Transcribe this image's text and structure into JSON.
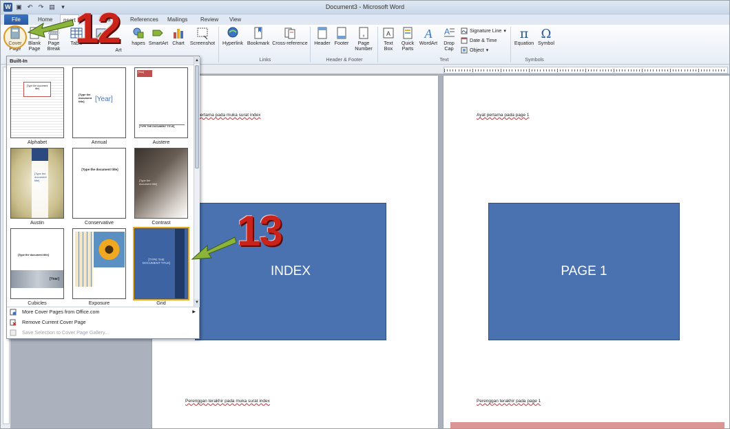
{
  "window": {
    "title": "Document3 - Microsoft Word"
  },
  "tabs": [
    "File",
    "Home",
    "Insert",
    "Page Layout",
    "References",
    "Mailings",
    "Review",
    "View"
  ],
  "tabs_visible": [
    "File",
    "Home",
    "nsert",
    "e La",
    "References",
    "Mailings",
    "Review",
    "View"
  ],
  "ribbon": {
    "pages": {
      "cover_page": "Cover\nPage",
      "blank_page": "Blank\nPage",
      "page_break": "Page\nBreak"
    },
    "tables": {
      "table": "Table"
    },
    "illustrations": {
      "art": "Art",
      "shapes": "hapes",
      "smartart": "SmartArt",
      "chart": "Chart",
      "screenshot": "Screenshot"
    },
    "links": {
      "hyperlink": "Hyperlink",
      "bookmark": "Bookmark",
      "cross_reference": "Cross-reference",
      "label": "Links"
    },
    "header_footer": {
      "header": "Header",
      "footer": "Footer",
      "page_number": "Page\nNumber",
      "label": "Header & Footer"
    },
    "text": {
      "text_box": "Text\nBox",
      "quick_parts": "Quick\nParts",
      "wordart": "WordArt",
      "drop_cap": "Drop\nCap",
      "signature_line": "Signature Line",
      "date_time": "Date & Time",
      "object": "Object",
      "label": "Text"
    },
    "symbols": {
      "equation": "Equation",
      "symbol": "Symbol",
      "label": "Symbols"
    }
  },
  "gallery": {
    "header": "Built-In",
    "items": [
      {
        "name": "Alphabet"
      },
      {
        "name": "Annual"
      },
      {
        "name": "Austere"
      },
      {
        "name": "Austin"
      },
      {
        "name": "Conservative"
      },
      {
        "name": "Contrast"
      },
      {
        "name": "Cubicles"
      },
      {
        "name": "Exposure"
      },
      {
        "name": "Grid"
      }
    ],
    "thumb_text": {
      "type_title": "[Type the document title]",
      "year": "[Year]",
      "type_title_upper": "[TYPE THE DOCUMENT TITLE]",
      "type_the_document_title_split": "[Type the document title]"
    },
    "menu": [
      {
        "label": "More Cover Pages from Office.com",
        "enabled": true
      },
      {
        "label": "Remove Current Cover Page",
        "enabled": true
      },
      {
        "label": "Save Selection to Cover Page Gallery...",
        "enabled": false
      }
    ]
  },
  "document": {
    "page1": {
      "top_text": "pertama pada muka surat index",
      "box_label": "INDEX",
      "bottom_text": "Perenggan terakhir pada muka surat index"
    },
    "page2": {
      "top_text": "Ayat pertama pada page 1",
      "box_label": "PAGE 1",
      "bottom_text": "Perenggan terakhir pada page 1"
    }
  },
  "annotations": {
    "step1": "12",
    "step2": "13"
  },
  "colors": {
    "accent": "#2b5797",
    "box_blue": "#4a72b0",
    "annotation_red": "#c9231c",
    "arrow_green": "#8bb43a",
    "selection_orange": "#e3a921"
  }
}
